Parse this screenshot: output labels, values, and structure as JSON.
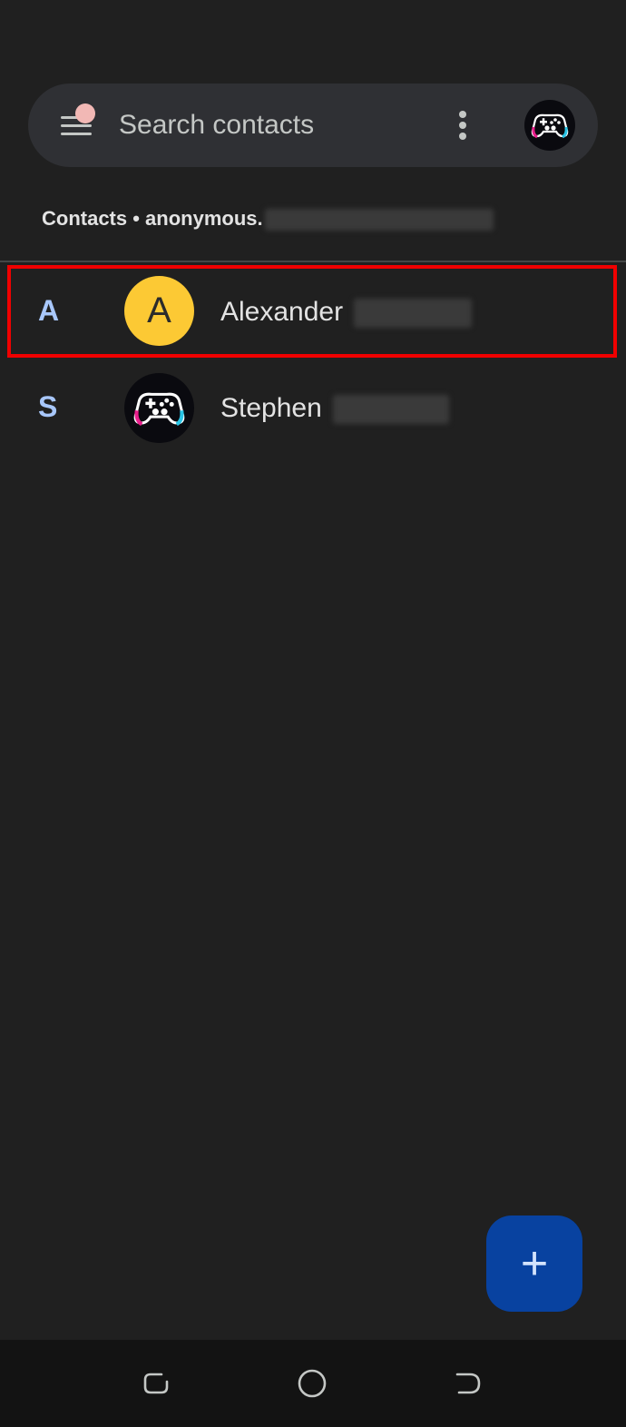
{
  "search": {
    "placeholder": "Search contacts"
  },
  "header": {
    "account_prefix": "Contacts • anonymous."
  },
  "contacts": [
    {
      "section": "A",
      "initial": "A",
      "name": "Alexander",
      "avatar": "letter-avatar",
      "avatar_color": "#fcc934"
    },
    {
      "section": "S",
      "initial": "",
      "name": "Stephen",
      "avatar": "gamepad-avatar"
    }
  ],
  "fab": {
    "label": "+",
    "icon": "add-icon"
  },
  "nav": {
    "recents_icon": "recents-icon",
    "home_icon": "home-icon",
    "back_icon": "back-icon"
  },
  "colors": {
    "background": "#202020",
    "search_bar": "#2f3034",
    "accent_letter": "#a8c7fa",
    "fab": "#0842a0",
    "highlight": "#f00000",
    "notification_dot": "#f2b8b5"
  }
}
